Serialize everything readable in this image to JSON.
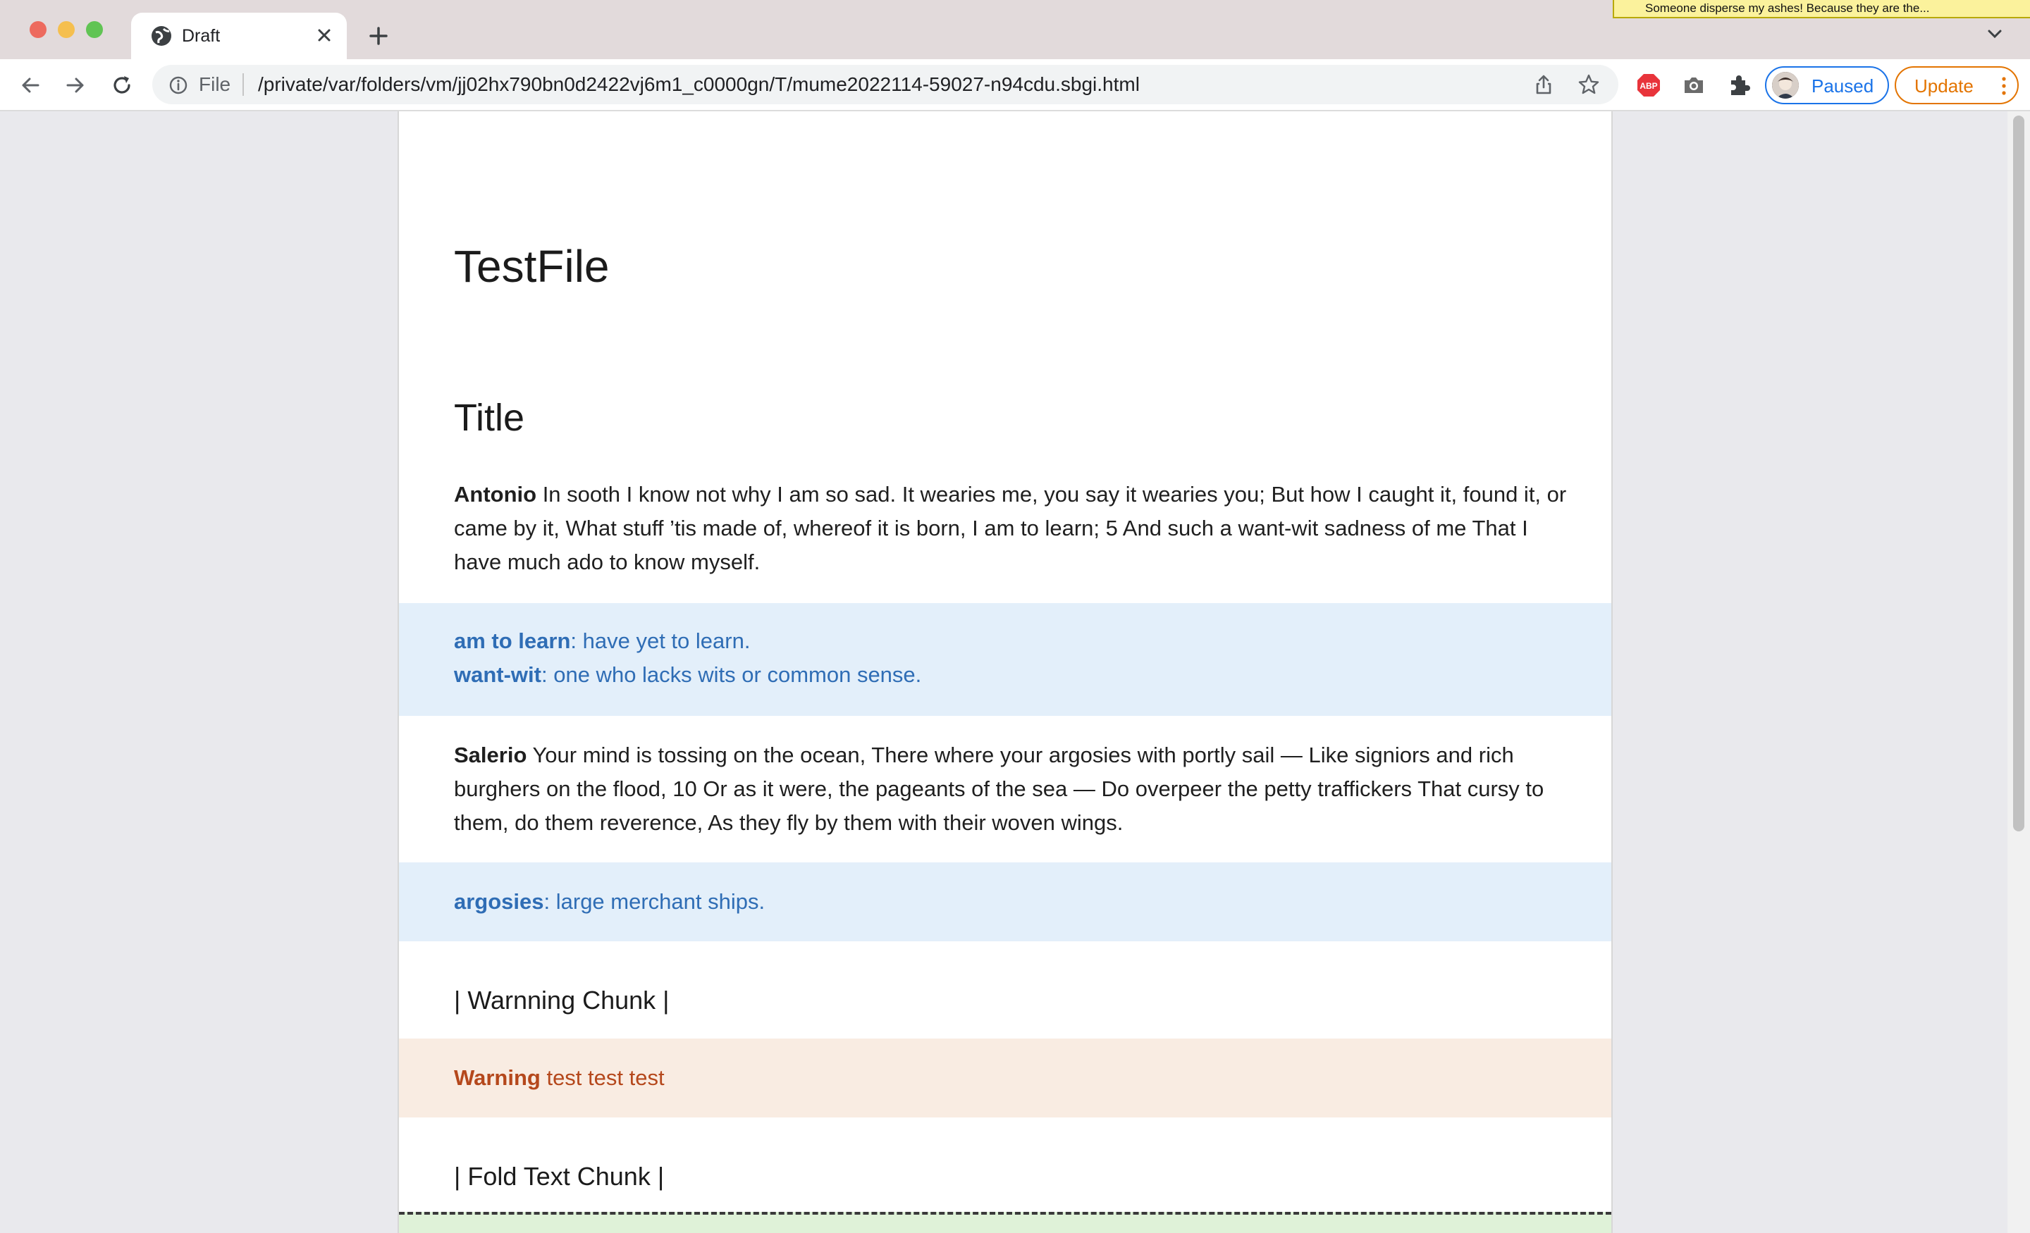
{
  "browser": {
    "tab_title": "Draft",
    "tooltip_text": "Someone disperse my ashes! Because they are the...",
    "omnibox_scheme": "File",
    "url": "/private/var/folders/vm/jj02hx790bn0d2422vj6m1_c0000gn/T/mume2022114-59027-n94cdu.sbgi.html",
    "profile_label": "Paused",
    "update_label": "Update",
    "extension_badge": "ABP"
  },
  "document": {
    "h1": "TestFile",
    "h2": "Title",
    "para1": {
      "speaker": "Antonio",
      "text": " In sooth I know not why I am so sad. It wearies me, you say it wearies you; But how I caught it, found it, or came by it, What stuff ’tis made of, whereof it is born, I am to learn; 5 And such a want-wit sadness of me That I have much ado to know myself."
    },
    "note1": [
      {
        "term": "am to learn",
        "definition": ": have yet to learn."
      },
      {
        "term": "want-wit",
        "definition": ": one who lacks wits or common sense."
      }
    ],
    "para2": {
      "speaker": "Salerio",
      "text": " Your mind is tossing on the ocean, There where your argosies with portly sail — Like signiors and rich burghers on the flood, 10 Or as it were, the pageants of the sea — Do overpeer the petty traffickers That cursy to them, do them reverence, As they fly by them with their woven wings."
    },
    "note2": [
      {
        "term": "argosies",
        "definition": ": large merchant ships."
      }
    ],
    "warning_chunk_heading": "| Warnning Chunk |",
    "warning": {
      "label": "Warning",
      "text": " test test test"
    },
    "fold_chunk_heading": "| Fold Text Chunk |"
  },
  "colors": {
    "note_bg": "#e3effa",
    "note_text": "#2f6db5",
    "warning_bg": "#f9ece2",
    "warning_text": "#b5481c",
    "fold_bg": "#dff2d8",
    "profile_accent": "#1a73e8",
    "update_accent": "#e37400"
  }
}
